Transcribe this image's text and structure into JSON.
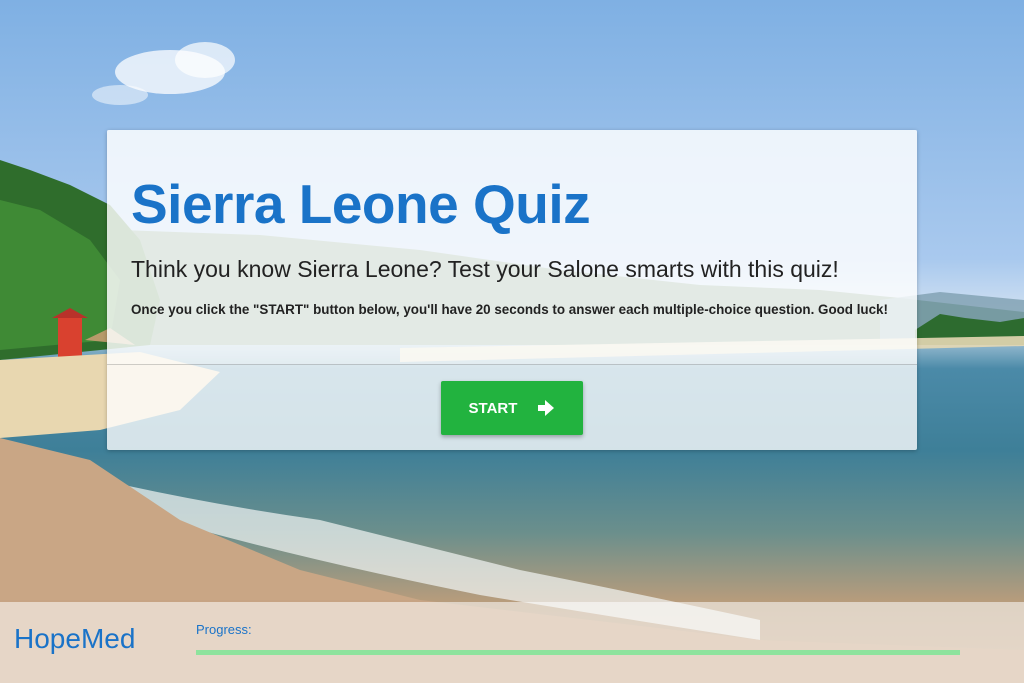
{
  "quiz": {
    "title": "Sierra Leone Quiz",
    "subtitle": "Think you know Sierra Leone? Test your Salone smarts with this quiz!",
    "instructions": "Once you click the \"START\" button below, you'll have 20 seconds to answer each multiple-choice question. Good luck!",
    "start_label": "START",
    "start_icon": "arrow-right-icon"
  },
  "footer": {
    "brand": "HopeMed",
    "progress_label": "Progress:",
    "progress_fraction": 1.0
  },
  "colors": {
    "accent": "#1a73c8",
    "button": "#22b33f",
    "progress": "#8ee39d"
  }
}
